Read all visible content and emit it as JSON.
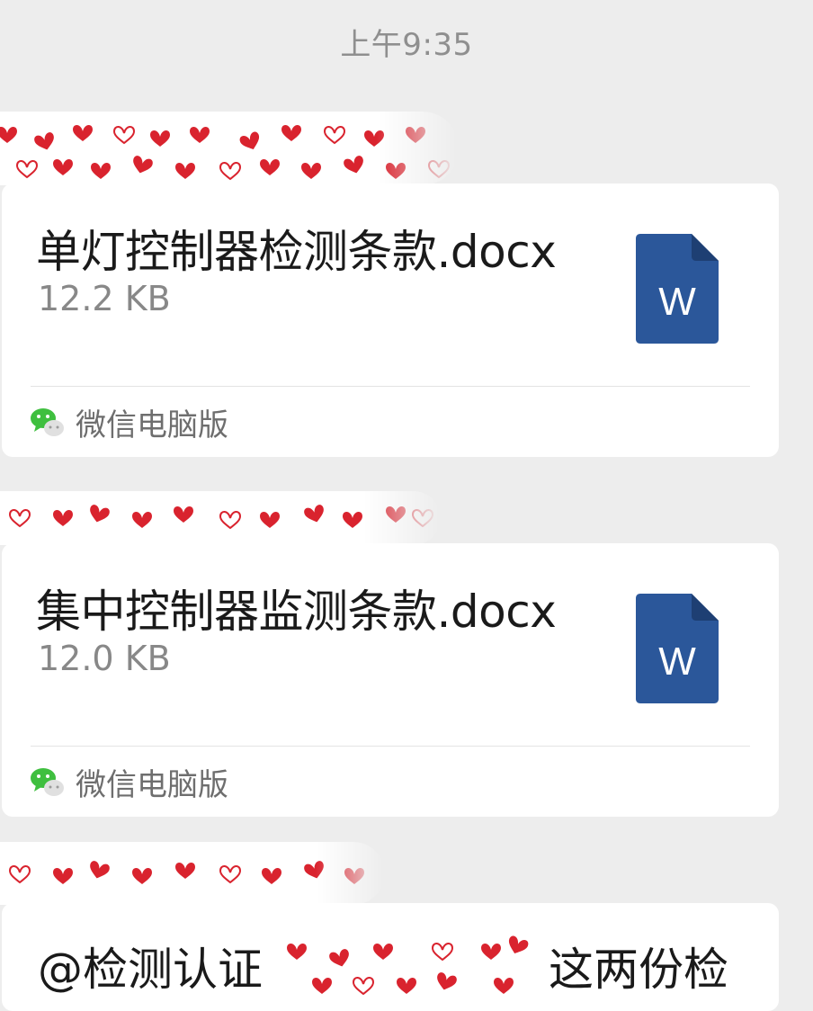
{
  "timestamp": "上午9:35",
  "messages": [
    {
      "type": "file",
      "file_name": "单灯控制器检测条款.docx",
      "file_size": "12.2 KB",
      "file_type_icon": "word-doc-icon",
      "file_icon_letter": "W",
      "source_label": "微信电脑版",
      "source_icon": "wechat-icon"
    },
    {
      "type": "file",
      "file_name": "集中控制器监测条款.docx",
      "file_size": "12.0 KB",
      "file_type_icon": "word-doc-icon",
      "file_icon_letter": "W",
      "source_label": "微信电脑版",
      "source_icon": "wechat-icon"
    },
    {
      "type": "text",
      "text_before_redaction": "@检测认证",
      "text_after_redaction": "这两份检"
    }
  ],
  "colors": {
    "background": "#ededed",
    "bubble": "#ffffff",
    "word_blue": "#2b579a",
    "heart_red": "#d9232e",
    "wechat_green": "#07c160"
  }
}
